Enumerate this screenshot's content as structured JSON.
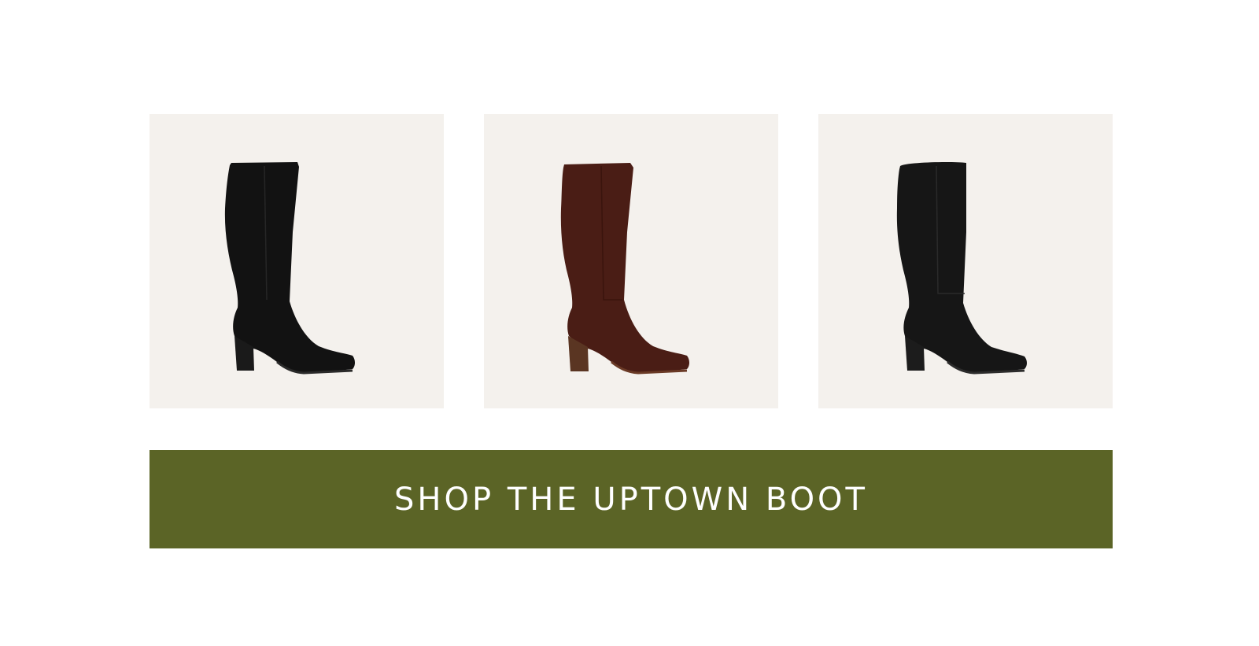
{
  "products": [
    {
      "name": "boot-black-suede",
      "icon": "knee-high-boot-icon",
      "color": "#121212",
      "heel_color": "#1a1a1a"
    },
    {
      "name": "boot-brown-suede",
      "icon": "knee-high-boot-icon",
      "color": "#4a1d15",
      "heel_color": "#5a3522"
    },
    {
      "name": "boot-black-leather",
      "icon": "knee-high-boot-icon",
      "color": "#161616",
      "heel_color": "#1c1c1c"
    }
  ],
  "cta": {
    "label": "SHOP THE UPTOWN BOOT",
    "background": "#5b6426",
    "text_color": "#ffffff"
  },
  "tile_background": "#f4f1ed"
}
